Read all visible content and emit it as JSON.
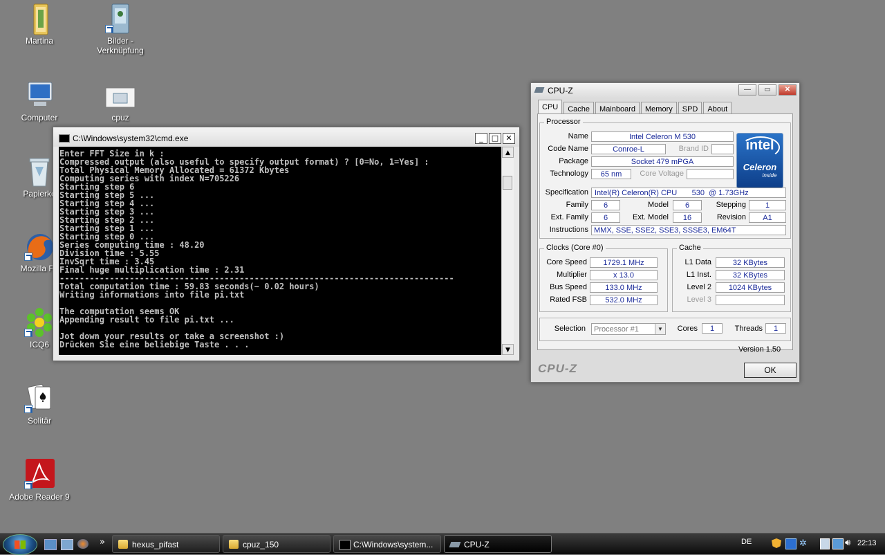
{
  "desktop": {
    "icons": [
      {
        "label": "Martina",
        "icon": "user-folder-icon"
      },
      {
        "label": "Bilder - Verknüpfung",
        "icon": "pictures-shortcut-icon"
      },
      {
        "label": "Computer",
        "icon": "computer-icon"
      },
      {
        "label": "cpuz",
        "icon": "cpuz-app-icon"
      },
      {
        "label": "Papierko",
        "icon": "recycle-bin-icon"
      },
      {
        "label": "Mozilla Fir",
        "icon": "firefox-icon"
      },
      {
        "label": "ICQ6",
        "icon": "icq-icon"
      },
      {
        "label": "Solitär",
        "icon": "solitaire-icon"
      },
      {
        "label": "Adobe Reader 9",
        "icon": "adobe-reader-icon"
      }
    ]
  },
  "cmd": {
    "title": "C:\\Windows\\system32\\cmd.exe",
    "minimize": "_",
    "maximize": "□",
    "close": "✕",
    "output": "Enter FFT Size in k :\nCompressed output (also useful to specify output format) ? [0=No, 1=Yes] :\nTotal Physical Memory Allocated = 61372 Kbytes\nComputing series with index N=705226\nStarting step 6\nStarting step 5 ...\nStarting step 4 ...\nStarting step 3 ...\nStarting step 2 ...\nStarting step 1 ...\nStarting step 0 ...\nSeries computing time : 48.20\nDivision time : 5.55\nInvSqrt time : 3.45\nFinal huge multiplication time : 2.31\n-------------------------------------------------------------------------------\nTotal computation time : 59.83 seconds(~ 0.02 hours)\nWriting informations into file pi.txt\n\nThe computation seems OK\nAppending result to file pi.txt ...\n\nJot down your results or take a screenshot :)\nDrücken Sie eine beliebige Taste . . ."
  },
  "cpuz": {
    "title": "CPU-Z",
    "tabs": [
      "CPU",
      "Cache",
      "Mainboard",
      "Memory",
      "SPD",
      "About"
    ],
    "active_tab": "CPU",
    "processor": {
      "legend": "Processor",
      "name_label": "Name",
      "name": "Intel Celeron M 530",
      "codename_label": "Code Name",
      "codename": "Conroe-L",
      "brandid_label": "Brand ID",
      "brandid": "",
      "package_label": "Package",
      "package": "Socket 479 mPGA",
      "technology_label": "Technology",
      "technology": "65 nm",
      "corevoltage_label": "Core Voltage",
      "corevoltage": "",
      "specification_label": "Specification",
      "specification": "Intel(R) Celeron(R) CPU       530  @ 1.73GHz",
      "family_label": "Family",
      "family": "6",
      "model_label": "Model",
      "model": "6",
      "stepping_label": "Stepping",
      "stepping": "1",
      "extfamily_label": "Ext. Family",
      "extfamily": "6",
      "extmodel_label": "Ext. Model",
      "extmodel": "16",
      "revision_label": "Revision",
      "revision": "A1",
      "instructions_label": "Instructions",
      "instructions": "MMX, SSE, SSE2, SSE3, SSSE3, EM64T",
      "logo_text": "intel",
      "logo_brand": "Celeron",
      "logo_tag": "inside"
    },
    "clocks": {
      "legend": "Clocks (Core #0)",
      "corespeed_label": "Core Speed",
      "corespeed": "1729.1 MHz",
      "multiplier_label": "Multiplier",
      "multiplier": "x 13.0",
      "busspeed_label": "Bus Speed",
      "busspeed": "133.0 MHz",
      "ratedfsb_label": "Rated FSB",
      "ratedfsb": "532.0 MHz"
    },
    "cache": {
      "legend": "Cache",
      "l1data_label": "L1 Data",
      "l1data": "32 KBytes",
      "l1inst_label": "L1 Inst.",
      "l1inst": "32 KBytes",
      "level2_label": "Level 2",
      "level2": "1024 KBytes",
      "level3_label": "Level 3",
      "level3": ""
    },
    "selection_label": "Selection",
    "selection": "Processor #1",
    "cores_label": "Cores",
    "cores": "1",
    "threads_label": "Threads",
    "threads": "1",
    "version": "Version 1.50",
    "brand": "CPU-Z",
    "ok": "OK"
  },
  "taskbar": {
    "tasks": [
      {
        "label": "hexus_pifast",
        "icon": "folder-icon"
      },
      {
        "label": "cpuz_150",
        "icon": "folder-icon"
      },
      {
        "label": "C:\\Windows\\system...",
        "icon": "cmd-icon"
      },
      {
        "label": "CPU-Z",
        "icon": "cpuz-icon"
      }
    ],
    "overflow": "»",
    "language": "DE",
    "clock": "22:13"
  }
}
